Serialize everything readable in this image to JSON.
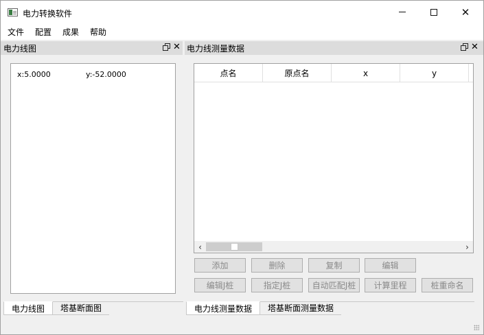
{
  "window": {
    "title": "电力转换软件",
    "controls": {
      "minimize": "minimize",
      "maximize": "maximize",
      "close": "✕"
    }
  },
  "menu": [
    "文件",
    "配置",
    "成果",
    "帮助"
  ],
  "left_panel": {
    "title": "电力线图",
    "coord_x": "x:5.0000",
    "coord_y": "y:-52.0000",
    "tabs": [
      "电力线图",
      "塔基断面图"
    ],
    "active_tab": 0
  },
  "right_panel": {
    "title": "电力线测量数据",
    "columns": [
      "点名",
      "原点名",
      "x",
      "y"
    ],
    "rows": [],
    "buttons_row1": [
      "添加",
      "删除",
      "复制",
      "编辑"
    ],
    "buttons_row2": [
      "编辑J桩",
      "指定J桩",
      "自动匹配J桩",
      "计算里程",
      "桩重命名"
    ],
    "tabs": [
      "电力线测量数据",
      "塔基断面测量数据"
    ],
    "active_tab": 0
  },
  "colors": {
    "dock_header": "#dcdcdc",
    "window_bg": "#f0f0f0",
    "disabled_text": "#8a8a8a"
  }
}
